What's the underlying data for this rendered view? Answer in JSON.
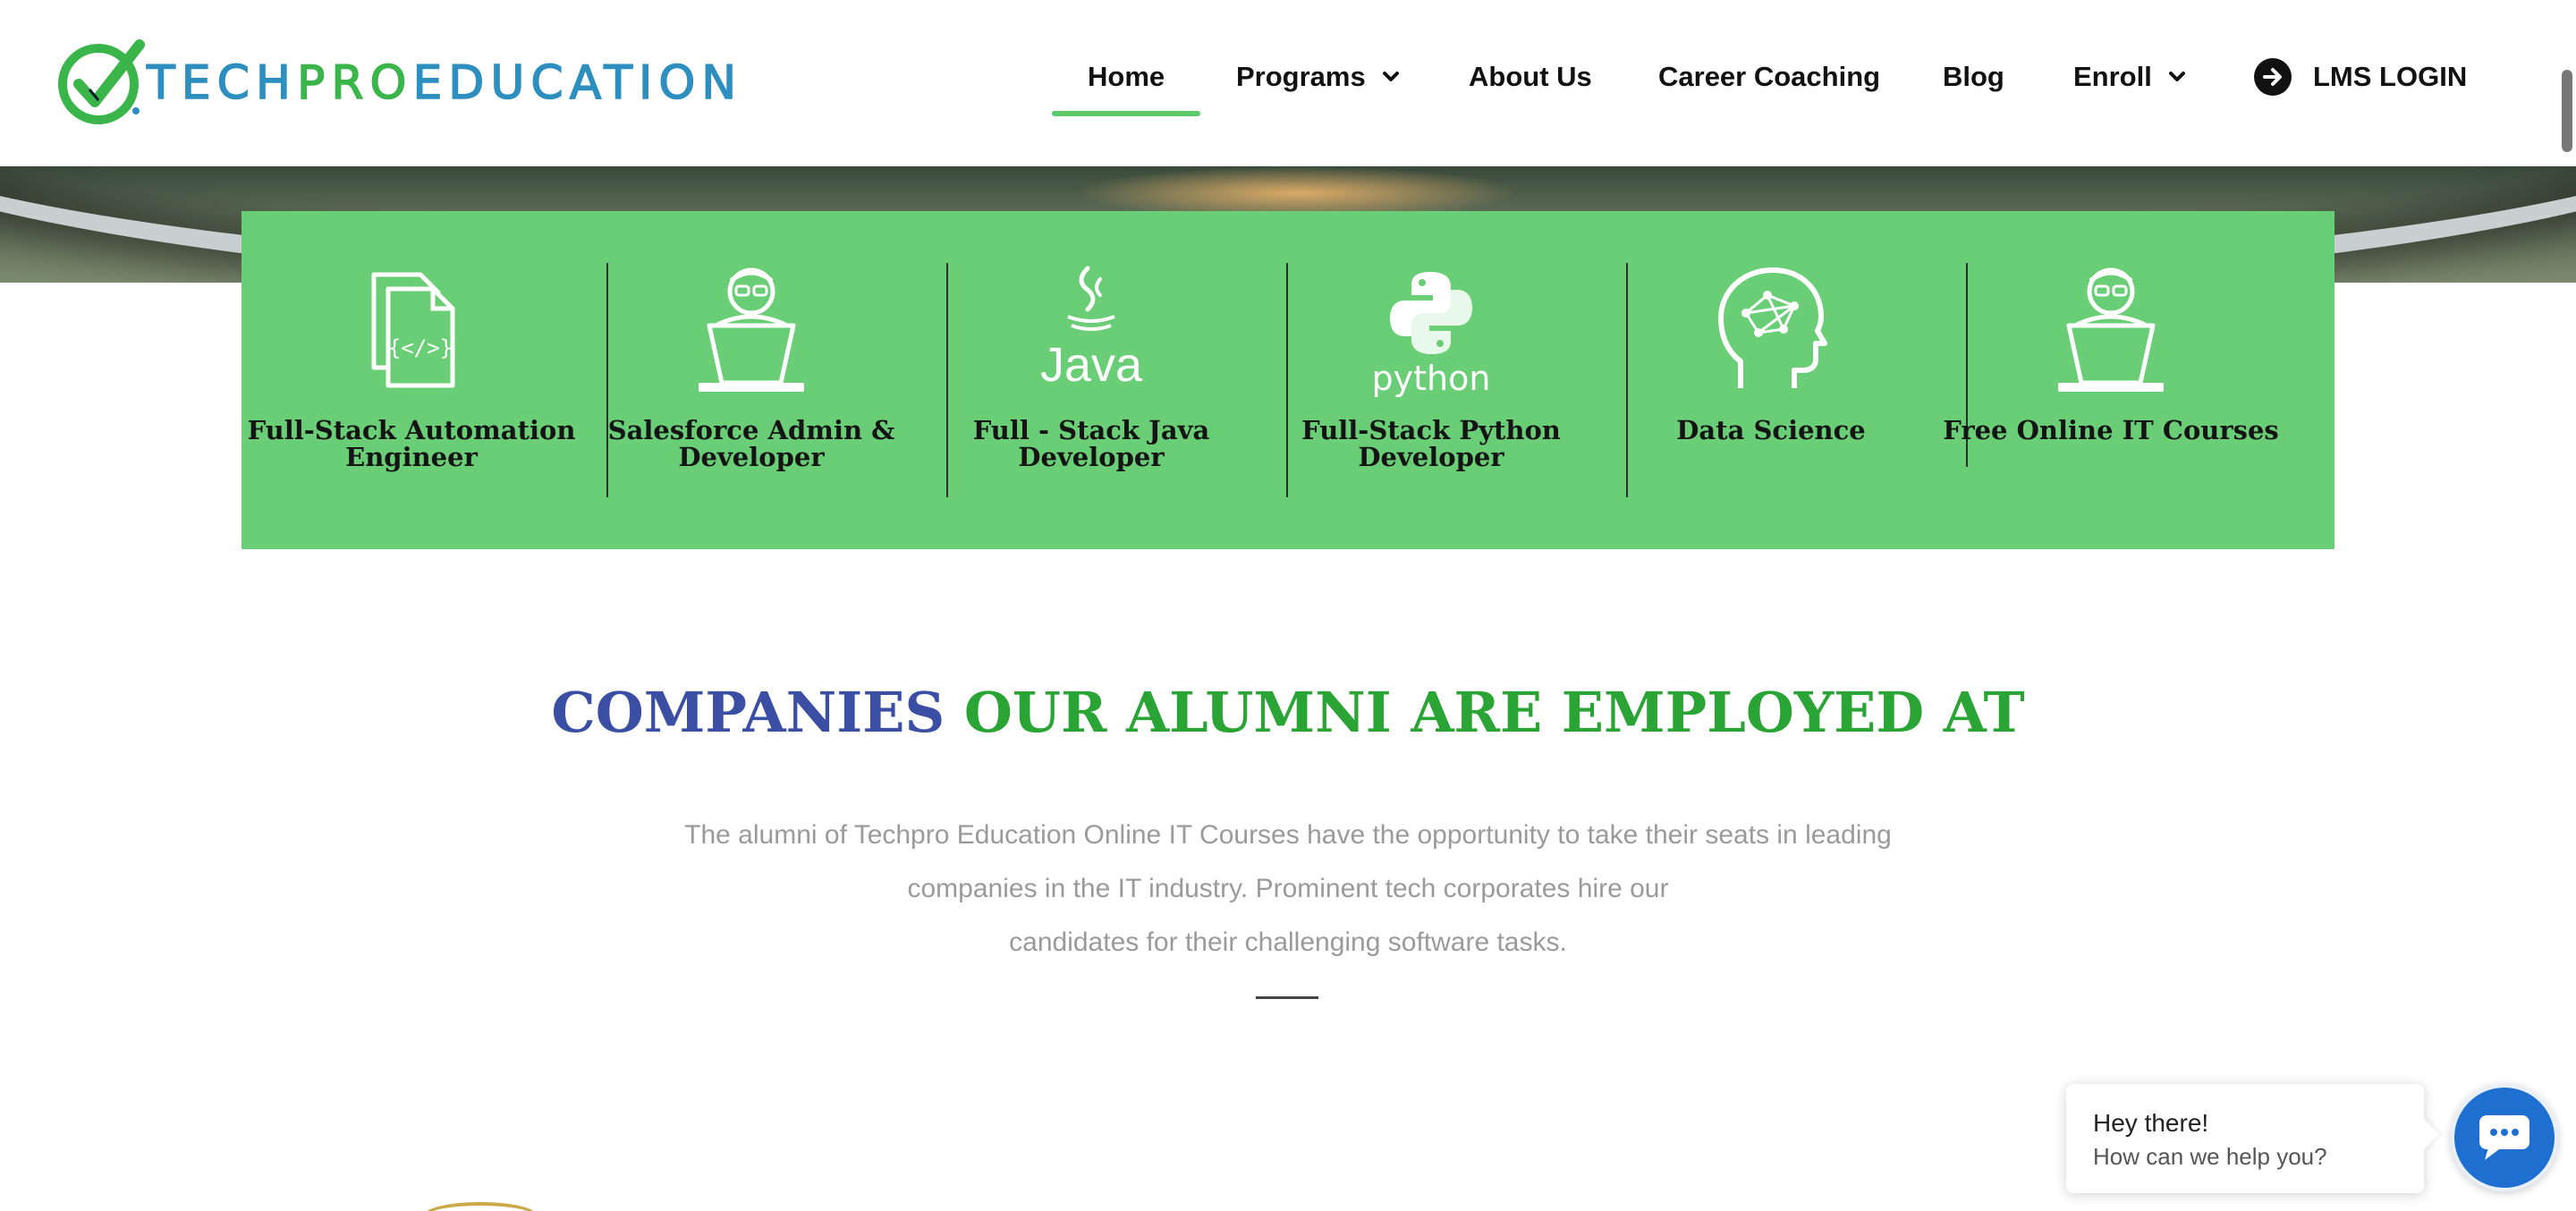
{
  "header": {
    "logo": {
      "part1": "TECH",
      "part2": "PRO",
      "part3": "EDUCATION"
    },
    "nav": [
      {
        "label": "Home",
        "active": true,
        "has_dropdown": false
      },
      {
        "label": "Programs",
        "active": false,
        "has_dropdown": true
      },
      {
        "label": "About Us",
        "active": false,
        "has_dropdown": false
      },
      {
        "label": "Career Coaching",
        "active": false,
        "has_dropdown": false
      },
      {
        "label": "Blog",
        "active": false,
        "has_dropdown": false
      },
      {
        "label": "Enroll",
        "active": false,
        "has_dropdown": true
      },
      {
        "label": "LMS LOGIN",
        "active": false,
        "has_dropdown": false,
        "icon": "arrow-circle-right-icon"
      }
    ]
  },
  "programs": [
    {
      "label_line1": "Full-Stack Automation",
      "label_line2": "Engineer",
      "icon": "code-file-icon"
    },
    {
      "label_line1": "Salesforce Admin &",
      "label_line2": "Developer",
      "icon": "developer-laptop-icon"
    },
    {
      "label_line1": "Full - Stack Java",
      "label_line2": "Developer",
      "icon": "java-logo-icon",
      "icon_text": "Java"
    },
    {
      "label_line1": "Full-Stack Python",
      "label_line2": "Developer",
      "icon": "python-logo-icon",
      "icon_text": "python"
    },
    {
      "label_line1": "Data Science",
      "label_line2": "",
      "icon": "brain-network-icon"
    },
    {
      "label_line1": "Free Online IT Courses",
      "label_line2": "",
      "icon": "developer-laptop-icon"
    }
  ],
  "companies": {
    "title_part1": "COMPANIES",
    "title_part2": "OUR ALUMNI ARE EMPLOYED AT",
    "text_line1": "The alumni of Techpro Education Online IT Courses have the opportunity to take their seats in leading",
    "text_line2": "companies in the IT industry. Prominent tech corporates hire our",
    "text_line3": "candidates for their challenging software tasks."
  },
  "chat": {
    "greeting": "Hey there!",
    "prompt": "How can we help you?"
  },
  "colors": {
    "accent_green": "#69ce76",
    "title_blue": "#3a4fa3",
    "title_green": "#2aa434",
    "chat_blue": "#1f6fd0"
  }
}
